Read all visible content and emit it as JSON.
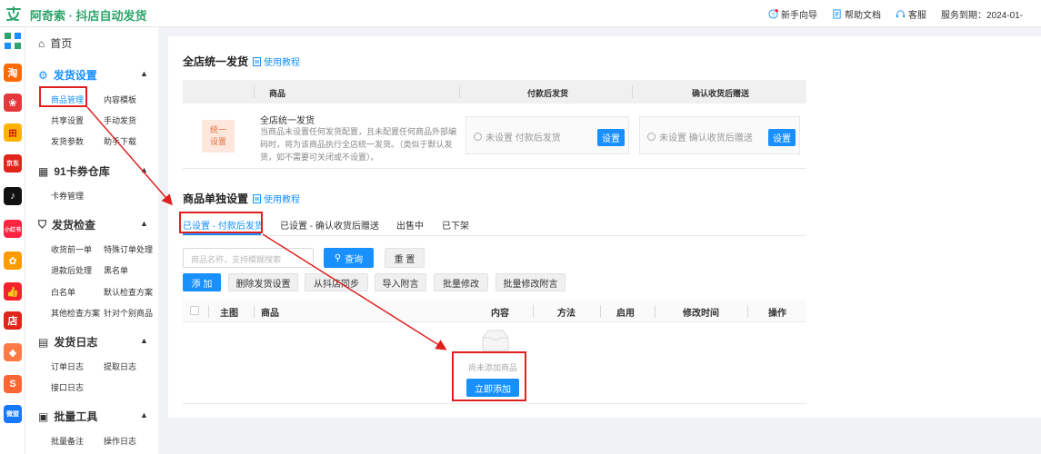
{
  "app": {
    "brand": "阿奇索 · 抖店自动发货"
  },
  "topbar": {
    "links": [
      {
        "label": "新手向导"
      },
      {
        "label": "帮助文档"
      },
      {
        "label": "客服"
      }
    ],
    "expire": "服务到期：2024-01-"
  },
  "apps": [
    {
      "label": "淘",
      "color": "#ff6a00"
    },
    {
      "label": "",
      "color": "#e4393c"
    },
    {
      "label": "田",
      "color": "#ffb300"
    },
    {
      "label": "京东",
      "color": "#e1251b"
    },
    {
      "label": "♪",
      "color": "#111111"
    },
    {
      "label": "小红书",
      "color": "#ff2442"
    },
    {
      "label": "",
      "color": "#ff9a00"
    },
    {
      "label": "",
      "color": "#f5222d"
    },
    {
      "label": "店",
      "color": "#e1251b"
    },
    {
      "label": "",
      "color": "#ff7a45"
    },
    {
      "label": "S",
      "color": "#ff6633"
    },
    {
      "label": "微盟",
      "color": "#1677ff"
    }
  ],
  "nav": {
    "home": "首页",
    "s1": {
      "title": "发货设置",
      "items": [
        "商品管理",
        "内容模板",
        "共享设置",
        "手动发货",
        "发货参数",
        "助手下载"
      ]
    },
    "s2": {
      "title": "91卡券仓库",
      "items": [
        "卡券管理"
      ]
    },
    "s3": {
      "title": "发货检查",
      "items": [
        "收货前一单",
        "特殊订单处理",
        "退款后处理",
        "黑名单",
        "白名单",
        "默认检查方案",
        "其他检查方案",
        "针对个别商品"
      ]
    },
    "s4": {
      "title": "发货日志",
      "items": [
        "订单日志",
        "提取日志",
        "接口日志"
      ]
    },
    "s5": {
      "title": "批量工具",
      "items": [
        "批量备注",
        "操作日志"
      ]
    }
  },
  "global": {
    "title": "全店统一发货",
    "tutorial": "使用教程",
    "headers": [
      "商品",
      "付款后发货",
      "确认收货后赠送"
    ],
    "badge": [
      "统一",
      "设置"
    ],
    "row_title": "全店统一发货",
    "row_desc": "当商品未设置任何发货配置，且未配置任何商品外部编码时，将为该商品执行全店统一发货。（类似于默认发货，如不需要可关闭或不设置）。",
    "opt1": "未设置 付款后发货",
    "opt2": "未设置 确认收货后赠送",
    "set_btn": "设置"
  },
  "single": {
    "title": "商品单独设置",
    "tutorial": "使用教程",
    "tabs": [
      "已设置 - 付款后发货",
      "已设置 - 确认收货后赠送",
      "出售中",
      "已下架"
    ],
    "search_placeholder": "商品名称，支持模糊搜索",
    "query_btn": "查询",
    "reset_btn": "重 置",
    "actions": [
      "添 加",
      "删除发货设置",
      "从抖店同步",
      "导入附言",
      "批量修改",
      "批量修改附言"
    ],
    "columns": [
      "主图",
      "商品",
      "内容",
      "方法",
      "启用",
      "修改时间",
      "操作"
    ],
    "empty_text": "尚未添加商品",
    "add_now": "立即添加"
  }
}
